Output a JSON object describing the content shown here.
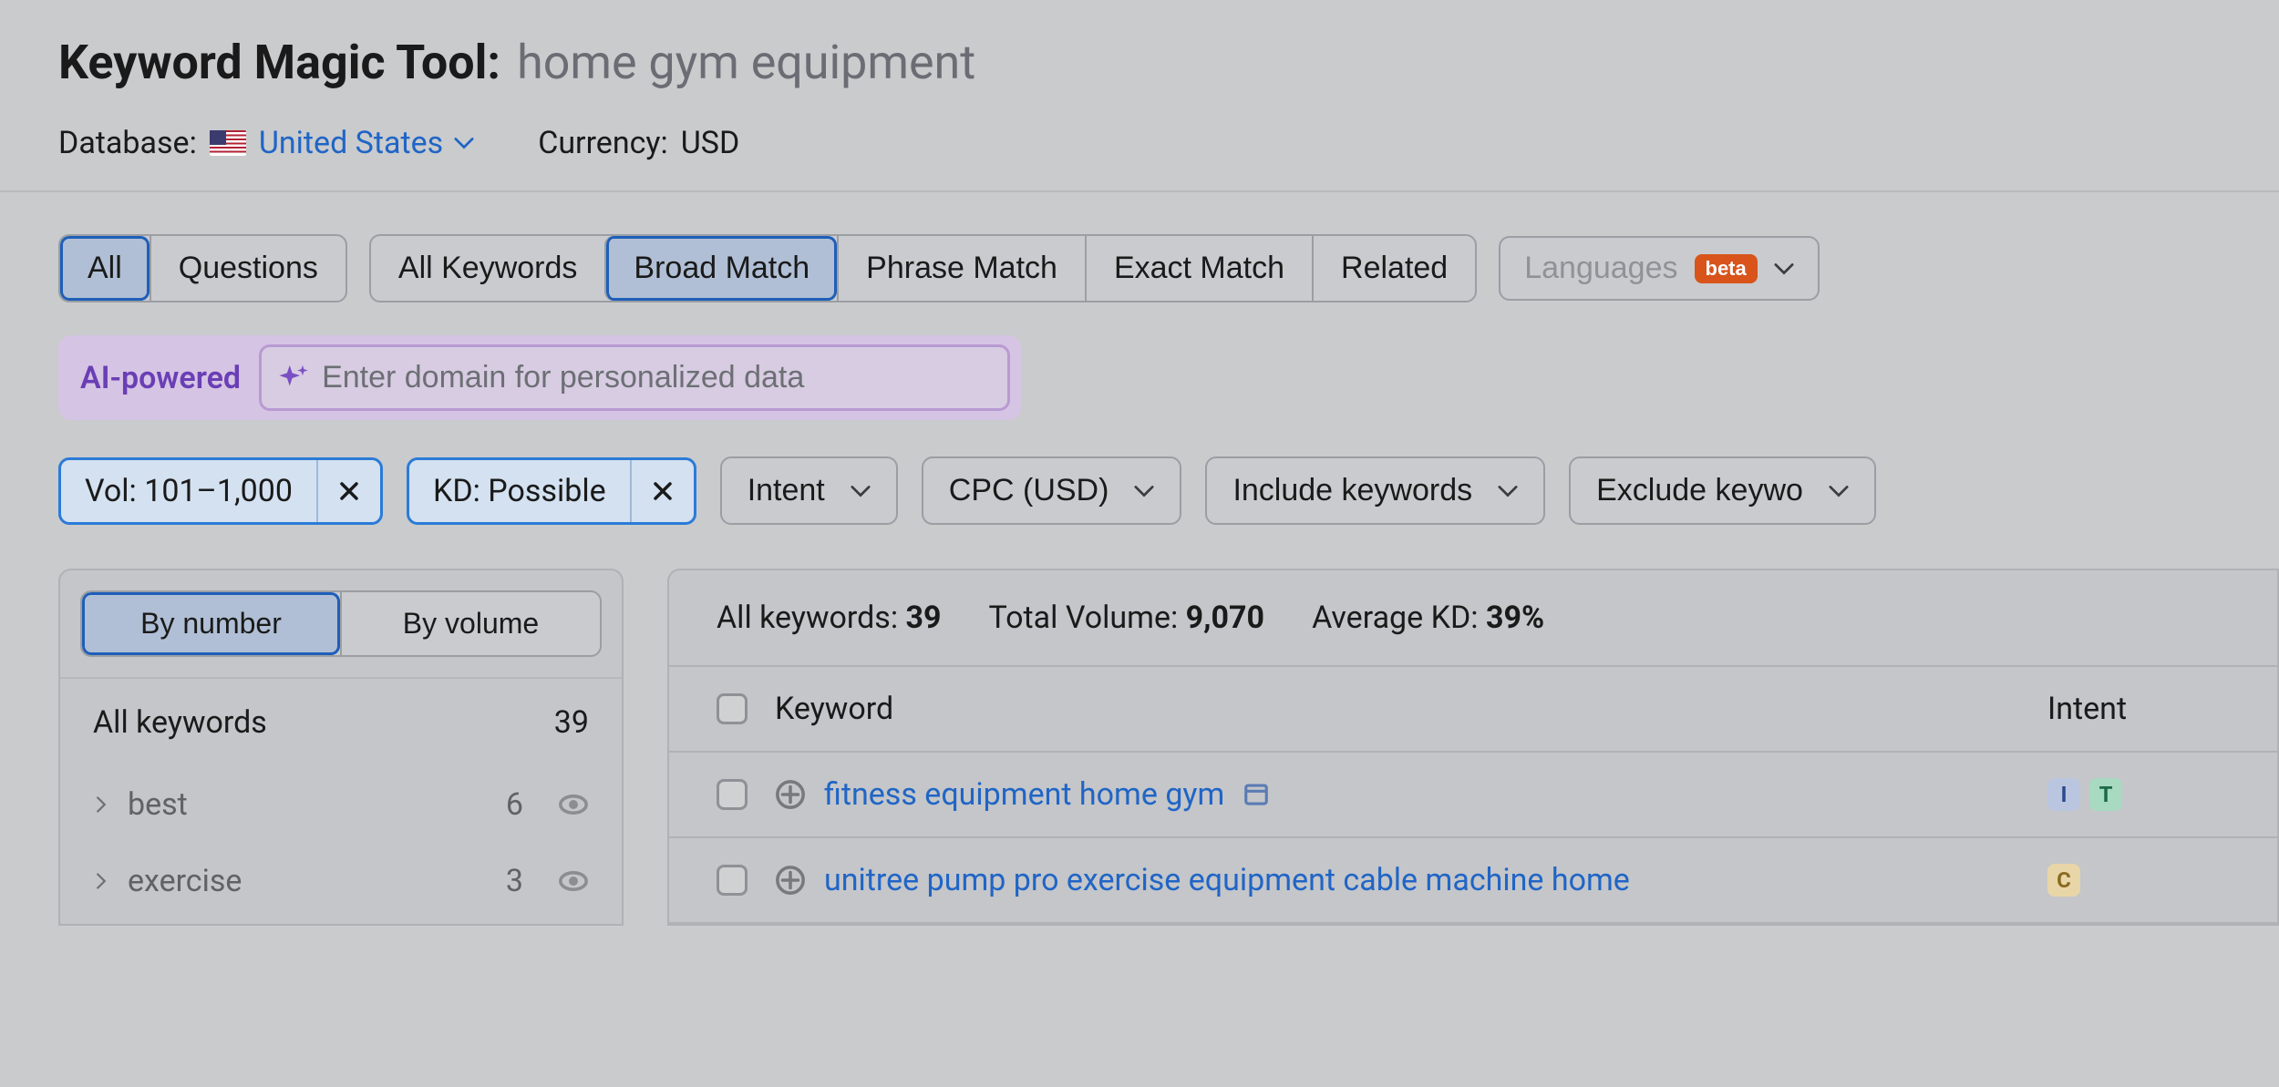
{
  "header": {
    "title_prefix": "Keyword Magic Tool:",
    "title_query": "home gym equipment",
    "database_label": "Database:",
    "database_value": "United States",
    "currency_label": "Currency:",
    "currency_value": "USD"
  },
  "tabs_group1": [
    {
      "label": "All",
      "active": true
    },
    {
      "label": "Questions",
      "active": false
    }
  ],
  "tabs_group2": [
    {
      "label": "All Keywords",
      "active": false
    },
    {
      "label": "Broad Match",
      "active": true
    },
    {
      "label": "Phrase Match",
      "active": false
    },
    {
      "label": "Exact Match",
      "active": false
    },
    {
      "label": "Related",
      "active": false
    }
  ],
  "languages": {
    "label": "Languages",
    "badge": "beta"
  },
  "ai": {
    "label": "AI-powered",
    "placeholder": "Enter domain for personalized data"
  },
  "active_filters": [
    {
      "label": "Vol: 101–1,000"
    },
    {
      "label": "KD: Possible"
    }
  ],
  "filter_dropdowns": [
    "Intent",
    "CPC (USD)",
    "Include keywords",
    "Exclude keywo"
  ],
  "sidebar": {
    "sort": [
      {
        "label": "By number",
        "active": true
      },
      {
        "label": "By volume",
        "active": false
      }
    ],
    "all_label": "All keywords",
    "all_count": "39",
    "groups": [
      {
        "label": "best",
        "count": "6"
      },
      {
        "label": "exercise",
        "count": "3"
      }
    ]
  },
  "stats": {
    "all_label": "All keywords:",
    "all_val": "39",
    "vol_label": "Total Volume:",
    "vol_val": "9,070",
    "kd_label": "Average KD:",
    "kd_val": "39%"
  },
  "table": {
    "head_keyword": "Keyword",
    "head_intent": "Intent",
    "rows": [
      {
        "keyword": "fitness equipment home gym",
        "intents": [
          "I",
          "T"
        ]
      },
      {
        "keyword": "unitree pump pro exercise equipment cable machine home",
        "intents": [
          "C"
        ]
      }
    ]
  }
}
